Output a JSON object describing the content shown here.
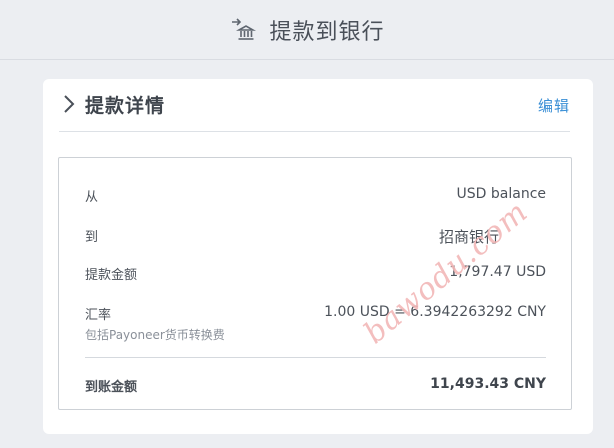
{
  "header": {
    "title": "提款到银行",
    "icon": "bank-transfer-icon"
  },
  "card": {
    "title": "提款详情",
    "edit_label": "编辑",
    "chevron_icon": "chevron-right-icon"
  },
  "details": {
    "from": {
      "label": "从",
      "value": "USD balance"
    },
    "to": {
      "label": "到",
      "value": "招商银行"
    },
    "amount": {
      "label": "提款金额",
      "value": "1,797.47 USD"
    },
    "rate": {
      "label": "汇率",
      "value": "1.00 USD = 6.3942263292 CNY",
      "note": "包括Payoneer货币转换费"
    },
    "total": {
      "label": "到账金额",
      "value": "11,493.43 CNY"
    }
  },
  "watermark": "bawodu.com",
  "colors": {
    "background": "#eceef2",
    "card": "#ffffff",
    "link": "#3a8fd6",
    "watermark": "#f2b7b7"
  }
}
